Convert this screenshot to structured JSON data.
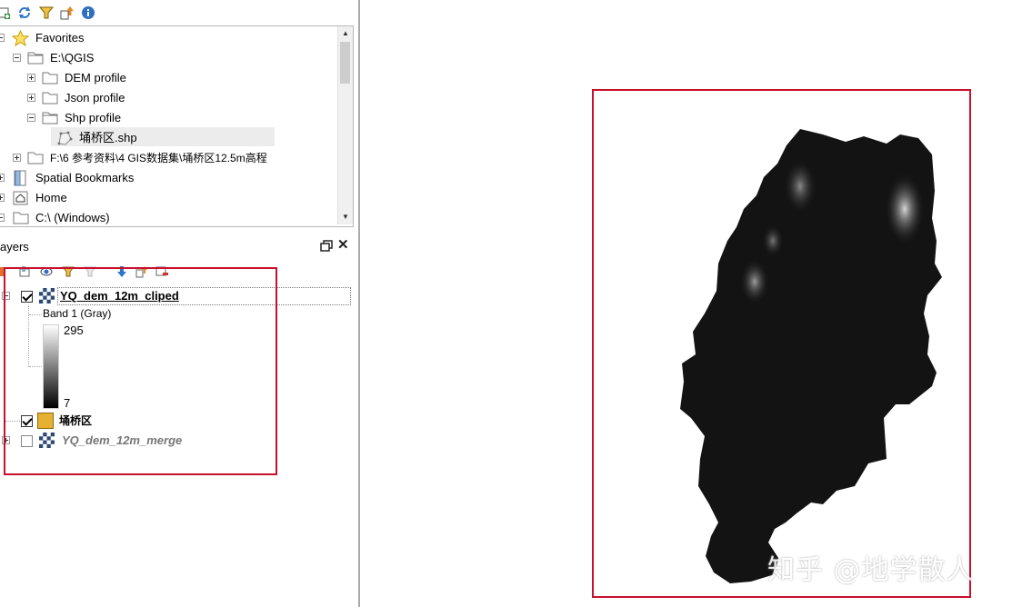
{
  "toolbar": {
    "icons": [
      "add-selected-layers-icon",
      "refresh-icon",
      "filter-icon",
      "collapse-all-icon",
      "info-icon"
    ]
  },
  "browser": {
    "items": [
      {
        "label": "Favorites",
        "icon": "star-icon"
      },
      {
        "label": "E:\\QGIS",
        "icon": "folder-open-icon"
      },
      {
        "label": "DEM profile",
        "icon": "folder-icon"
      },
      {
        "label": "Json profile",
        "icon": "folder-icon"
      },
      {
        "label": "Shp profile",
        "icon": "folder-open-icon"
      },
      {
        "label": "埇桥区.shp",
        "icon": "polygon-layer-icon"
      },
      {
        "label": "F:\\6 参考资料\\4 GIS数据集\\埇桥区12.5m高程",
        "icon": "folder-icon"
      },
      {
        "label": "Spatial Bookmarks",
        "icon": "bookmarks-icon"
      },
      {
        "label": "Home",
        "icon": "home-icon"
      },
      {
        "label": "C:\\ (Windows)",
        "icon": "folder-icon"
      }
    ]
  },
  "layers_panel": {
    "title": "ayers",
    "restore_icon": "restore-window-icon",
    "close_label": "✕",
    "toolbar_icons": [
      "open-layer-styling-icon",
      "add-group-icon",
      "manage-map-themes-icon",
      "filter-legend-icon",
      "filter-by-expression-icon",
      "expand-all-icon",
      "collapse-all-icon",
      "remove-layer-icon"
    ]
  },
  "layers": [
    {
      "name": "YQ_dem_12m_cliped",
      "checked": true,
      "type": "raster"
    },
    {
      "name": "埇桥区",
      "checked": true,
      "type": "polygon",
      "color": "#e8b030"
    },
    {
      "name": "YQ_dem_12m_merge",
      "checked": false,
      "type": "raster"
    }
  ],
  "legend": {
    "band_label": "Band 1 (Gray)",
    "max": "295",
    "min": "7"
  },
  "colors": {
    "highlight": "#c8102e",
    "polygon_fill": "#e8b030",
    "dem_dark": "#111111"
  },
  "watermark": "知乎 @地学散人"
}
